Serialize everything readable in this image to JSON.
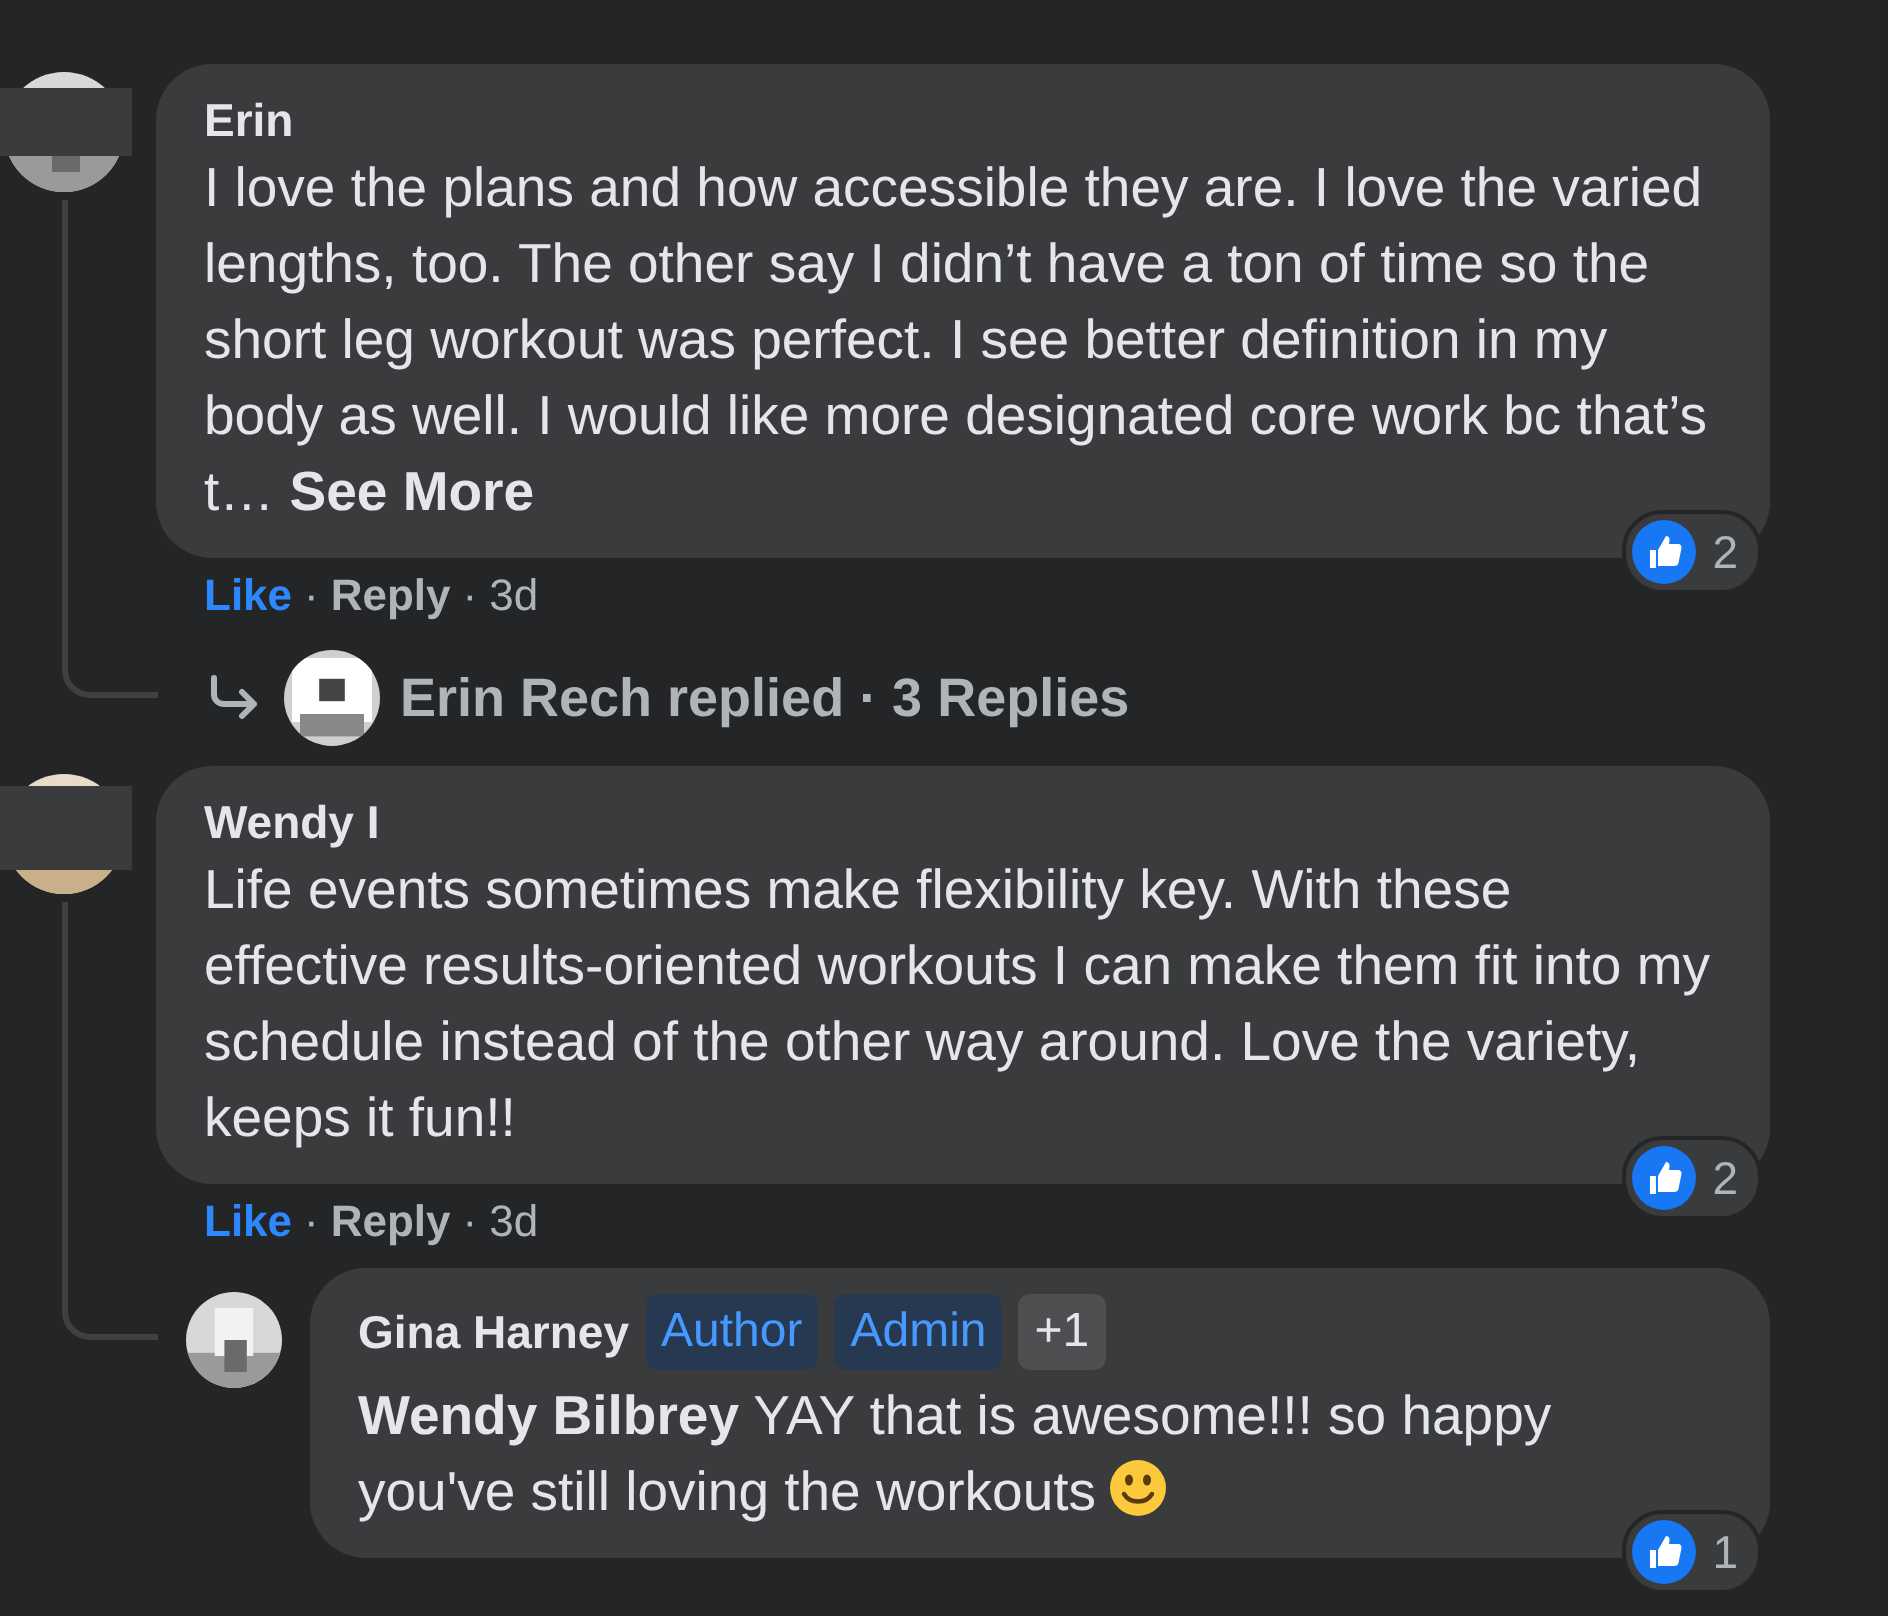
{
  "comments": [
    {
      "author": "Erin",
      "text": "I love the plans and how accessible they are. I love the varied lengths, too. The other say I didn’t have a ton of time so the short leg workout was perfect. I see better definition in my body as well. I would like more designated core work bc that’s t…",
      "see_more": "See More",
      "reactions": "2",
      "actions": [
        {
          "kind": "like",
          "label": "Like",
          "liked": true
        },
        {
          "kind": "separator",
          "label": "·"
        },
        {
          "kind": "reply",
          "label": "Reply"
        },
        {
          "kind": "separator",
          "label": "·"
        },
        {
          "kind": "time",
          "label": "3d"
        }
      ],
      "reply_summary": "Erin Rech replied · 3 Replies"
    },
    {
      "author": "Wendy I",
      "text": "Life events sometimes make flexibility key. With these effective results-oriented workouts I can make them fit into my schedule instead of the other way around. Love the variety, keeps it fun!!",
      "reactions": "2",
      "actions": [
        {
          "kind": "like",
          "label": "Like",
          "liked": true
        },
        {
          "kind": "separator",
          "label": "·"
        },
        {
          "kind": "reply",
          "label": "Reply"
        },
        {
          "kind": "separator",
          "label": "·"
        },
        {
          "kind": "time",
          "label": "3d"
        }
      ],
      "replies": [
        {
          "author": "Gina Harney",
          "badges": [
            {
              "kind": "role",
              "label": "Author"
            },
            {
              "kind": "role",
              "label": "Admin"
            },
            {
              "kind": "more",
              "label": "+1"
            }
          ],
          "text": "**Wendy Bilbrey** YAY that is awesome!!! so happy you've still loving the workouts",
          "reactions": "1"
        }
      ]
    }
  ]
}
